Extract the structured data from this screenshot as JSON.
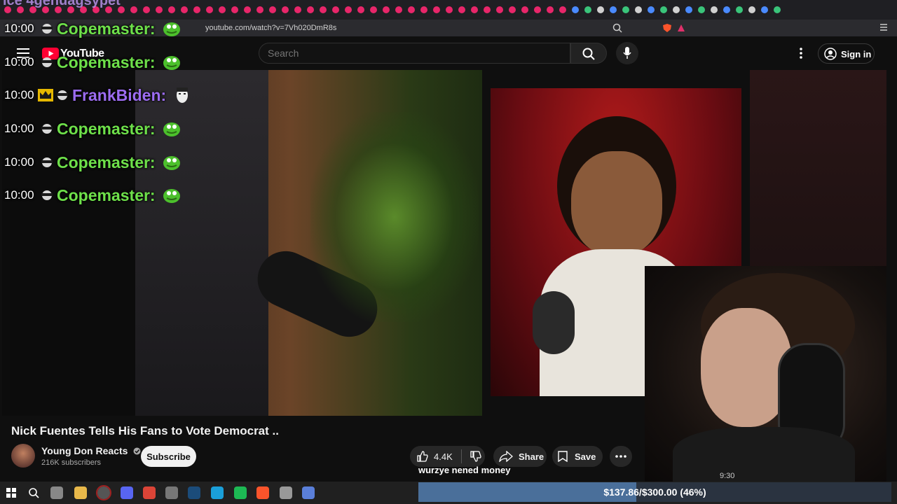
{
  "browser": {
    "cut_title": "ice 4genuagsypet",
    "url": "youtube.com/watch?v=7Vh020DmR8s",
    "tab_dot_color": "#e8266a"
  },
  "youtube": {
    "logo_text": "YouTube",
    "search_placeholder": "Search",
    "signin_label": "Sign in"
  },
  "chat": {
    "messages": [
      {
        "time": "10:00",
        "user": "Copemaster:",
        "color": "#6ee04a"
      },
      {
        "time": "10:00",
        "user": "Copemaster:",
        "color": "#6ee04a"
      },
      {
        "time": "10:00",
        "user": "FrankBiden:",
        "color": "#9c6cf0"
      },
      {
        "time": "10:00",
        "user": "Copemaster:",
        "color": "#6ee04a"
      },
      {
        "time": "10:00",
        "user": "Copemaster:",
        "color": "#6ee04a"
      },
      {
        "time": "10:00",
        "user": "Copemaster:",
        "color": "#6ee04a"
      }
    ]
  },
  "video": {
    "title": "Nick Fuentes Tells His Fans to Vote Democrat ..",
    "channel": "Young Don Reacts",
    "subscribers": "216K subscribers",
    "subscribe_label": "Subscribe",
    "likes": "4.4K",
    "share_label": "Share",
    "save_label": "Save"
  },
  "overlay": {
    "ticker_text": "wurzye nened money",
    "webcam_time": "9:30",
    "goal_text": "$137.86/$300.00 (46%)",
    "goal_fraction": 0.46
  },
  "colors": {
    "accent_green": "#6ee04a",
    "accent_purple": "#9c6cf0",
    "yt_red": "#ff0033"
  }
}
